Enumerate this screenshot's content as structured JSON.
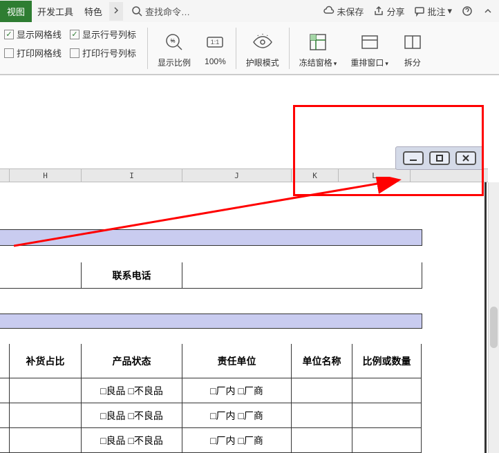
{
  "tabs": {
    "active": "视图",
    "items": [
      "开发工具",
      "特色"
    ],
    "search": "查找命令…"
  },
  "topRight": {
    "unsaved": "未保存",
    "share": "分享",
    "comment": "批注"
  },
  "toolbar": {
    "showGrid": "显示网格线",
    "showRowCol": "显示行号列标",
    "printGrid": "打印网格线",
    "printRowCol": "打印行号列标",
    "zoomRatio": "显示比例",
    "zoom100": "100%",
    "eyeProtect": "护眼模式",
    "freezePane": "冻结窗格",
    "rearrange": "重排窗口",
    "split": "拆分"
  },
  "columns": [
    "H",
    "I",
    "J",
    "K",
    "L"
  ],
  "table": {
    "contactPhone": "联系电话",
    "headers": [
      "补货占比",
      "产品状态",
      "责任单位",
      "单位名称",
      "比例或数量"
    ],
    "optGood": "□良品",
    "optBad": "□不良品",
    "optFactoryIn": "□厂内",
    "optFactoryVendor": "□厂商"
  }
}
